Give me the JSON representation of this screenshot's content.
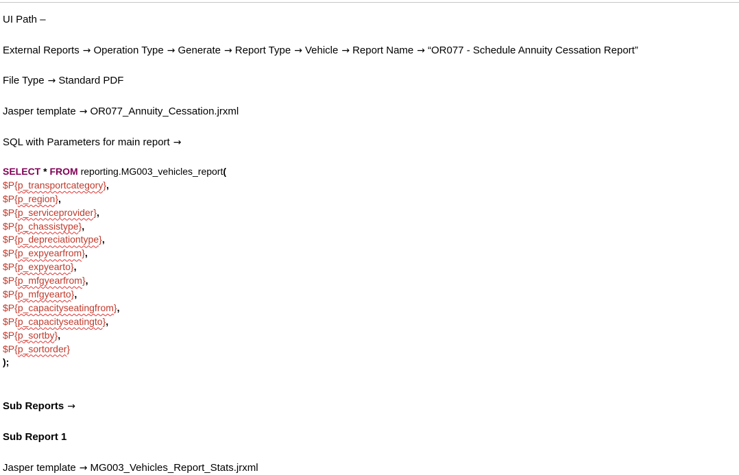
{
  "arrow_glyph": "→",
  "ui_path_label": "UI Path –",
  "ui_path_steps": [
    "External Reports",
    "Operation Type",
    "Generate",
    "Report Type",
    "Vehicle",
    "Report Name",
    "“OR077 - Schedule Annuity Cessation Report”"
  ],
  "file_type": {
    "label": "File Type",
    "value": "Standard PDF"
  },
  "jasper_main": {
    "label": "Jasper template",
    "value": "OR077_Annuity_Cessation.jrxml"
  },
  "sql_label": "SQL with Parameters for main report",
  "sql": {
    "select_kw": "SELECT",
    "star": "*",
    "from_kw": "FROM",
    "function": "reporting.MG003_vehicles_report",
    "open_paren": "(",
    "param_prefix": "$P{",
    "params": [
      "p_transportcategory",
      "p_region",
      "p_serviceprovider",
      "p_chassistype",
      "p_depreciationtype",
      "p_expyearfrom",
      "p_expyearto",
      "p_mfgyearfrom",
      "p_mfgyearto",
      "p_capacityseatingfrom",
      "p_capacityseatingto",
      "p_sortby",
      "p_sortorder"
    ],
    "close": ");"
  },
  "sub_reports_label": "Sub Reports",
  "sub_report_1_label": "Sub Report 1",
  "jasper_sub": {
    "label": "Jasper template",
    "value": "MG003_Vehicles_Report_Stats.jrxml"
  },
  "colors": {
    "keyword": "#7f0055",
    "parameter": "#c0392b",
    "spellcheck": "#e03030",
    "divider": "#c6c6c6"
  }
}
